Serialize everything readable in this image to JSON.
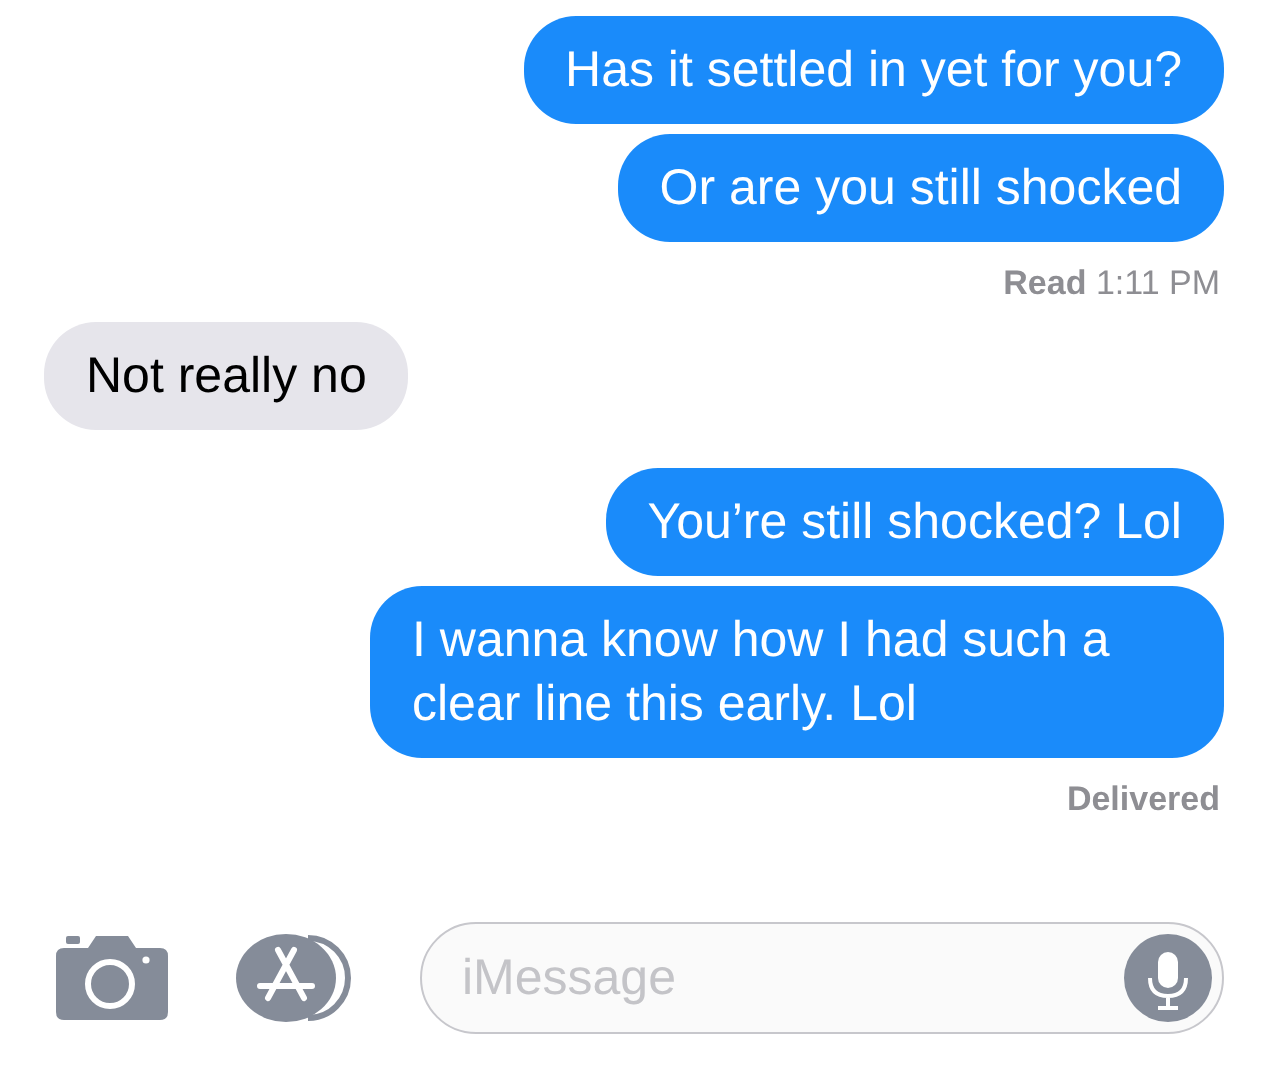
{
  "messages": [
    {
      "kind": "sent",
      "text": "Has it settled in yet for you?"
    },
    {
      "kind": "sent",
      "text": "Or are you still shocked"
    },
    {
      "kind": "receipt",
      "text": "**Read** 1:11 PM"
    },
    {
      "kind": "received",
      "text": "Not really no"
    },
    {
      "kind": "sent",
      "text": "You’re still shocked? Lol"
    },
    {
      "kind": "sent",
      "text": "I wanna know how I had such a clear line this early. Lol"
    },
    {
      "kind": "receipt",
      "text": "**Delivered**"
    }
  ],
  "composer": {
    "placeholder": "iMessage"
  }
}
